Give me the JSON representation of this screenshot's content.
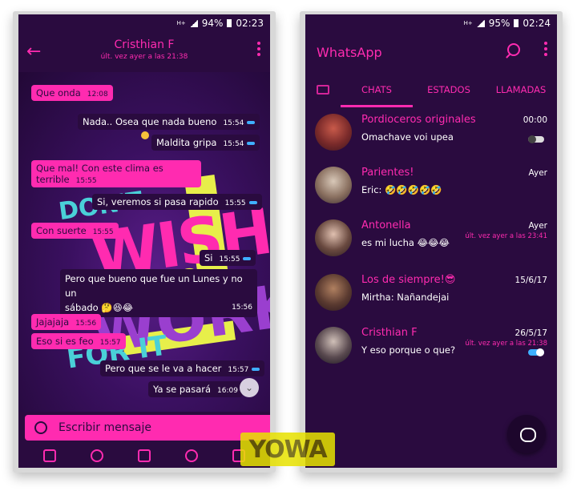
{
  "left_phone": {
    "status": {
      "network": "H+",
      "battery": "94%",
      "time": "02:23"
    },
    "header": {
      "contact_name": "Cristhian F",
      "last_seen": "últ. vez ayer a las 21:38"
    },
    "wallpaper": {
      "line1": "DON'T",
      "line2": "WISH",
      "line3": "FOR",
      "line4": "WORK",
      "line5": "FOR IT"
    },
    "messages": [
      {
        "text": "Que onda",
        "time": "12:08",
        "dir": "in"
      },
      {
        "text": "Nada.. Osea que nada bueno",
        "time": "15:54",
        "dir": "out"
      },
      {
        "text": "Maldita gripa",
        "time": "15:54",
        "dir": "out"
      },
      {
        "text": "Que mal! Con este clima es terrible",
        "time": "15:55",
        "dir": "in"
      },
      {
        "text": "Si, veremos si pasa rapido",
        "time": "15:55",
        "dir": "out"
      },
      {
        "text": "Con suerte",
        "time": "15:55",
        "dir": "in"
      },
      {
        "text": "Si",
        "time": "15:55",
        "dir": "out"
      },
      {
        "text": "Pero que bueno que fue un Lunes y no un",
        "text2": "sábado 🤔😆😂",
        "time": "15:56",
        "dir": "out"
      },
      {
        "text": "Jajajaja",
        "time": "15:56",
        "dir": "in"
      },
      {
        "text": "Eso si es feo",
        "time": "15:57",
        "dir": "in"
      },
      {
        "text": "Pero que se le va a hacer",
        "time": "15:57",
        "dir": "out"
      },
      {
        "text": "Ya se pasará",
        "time": "16:09",
        "dir": "out"
      }
    ],
    "compose": {
      "placeholder": "Escribir mensaje"
    }
  },
  "right_phone": {
    "status": {
      "network": "H+",
      "battery": "95%",
      "time": "02:24"
    },
    "app_title": "WhatsApp",
    "tabs": [
      "CHATS",
      "ESTADOS",
      "LLAMADAS"
    ],
    "chats": [
      {
        "name": "Pordioceros originales",
        "preview": "Omachave voi upea",
        "date": "00:00",
        "sub": ""
      },
      {
        "name": "Parientes!",
        "preview": "Eric: 🤣🤣🤣🤣🤣",
        "date": "Ayer",
        "sub": ""
      },
      {
        "name": "Antonella",
        "preview": "es mi lucha 😂😂😂",
        "date": "Ayer",
        "sub": "últ. vez ayer a las 23:41"
      },
      {
        "name": "Los de siempre!😎",
        "preview": "Mirtha: Nañandejai",
        "date": "15/6/17",
        "sub": ""
      },
      {
        "name": "Cristhian F",
        "preview": "Y eso porque o que?",
        "date": "26/5/17",
        "sub": "últ. vez ayer a las 21:38"
      }
    ]
  },
  "watermark": "YOWA",
  "colors": {
    "accent": "#ff2bb0",
    "background": "#2a0b3f",
    "tick": "#3fb0ff"
  }
}
